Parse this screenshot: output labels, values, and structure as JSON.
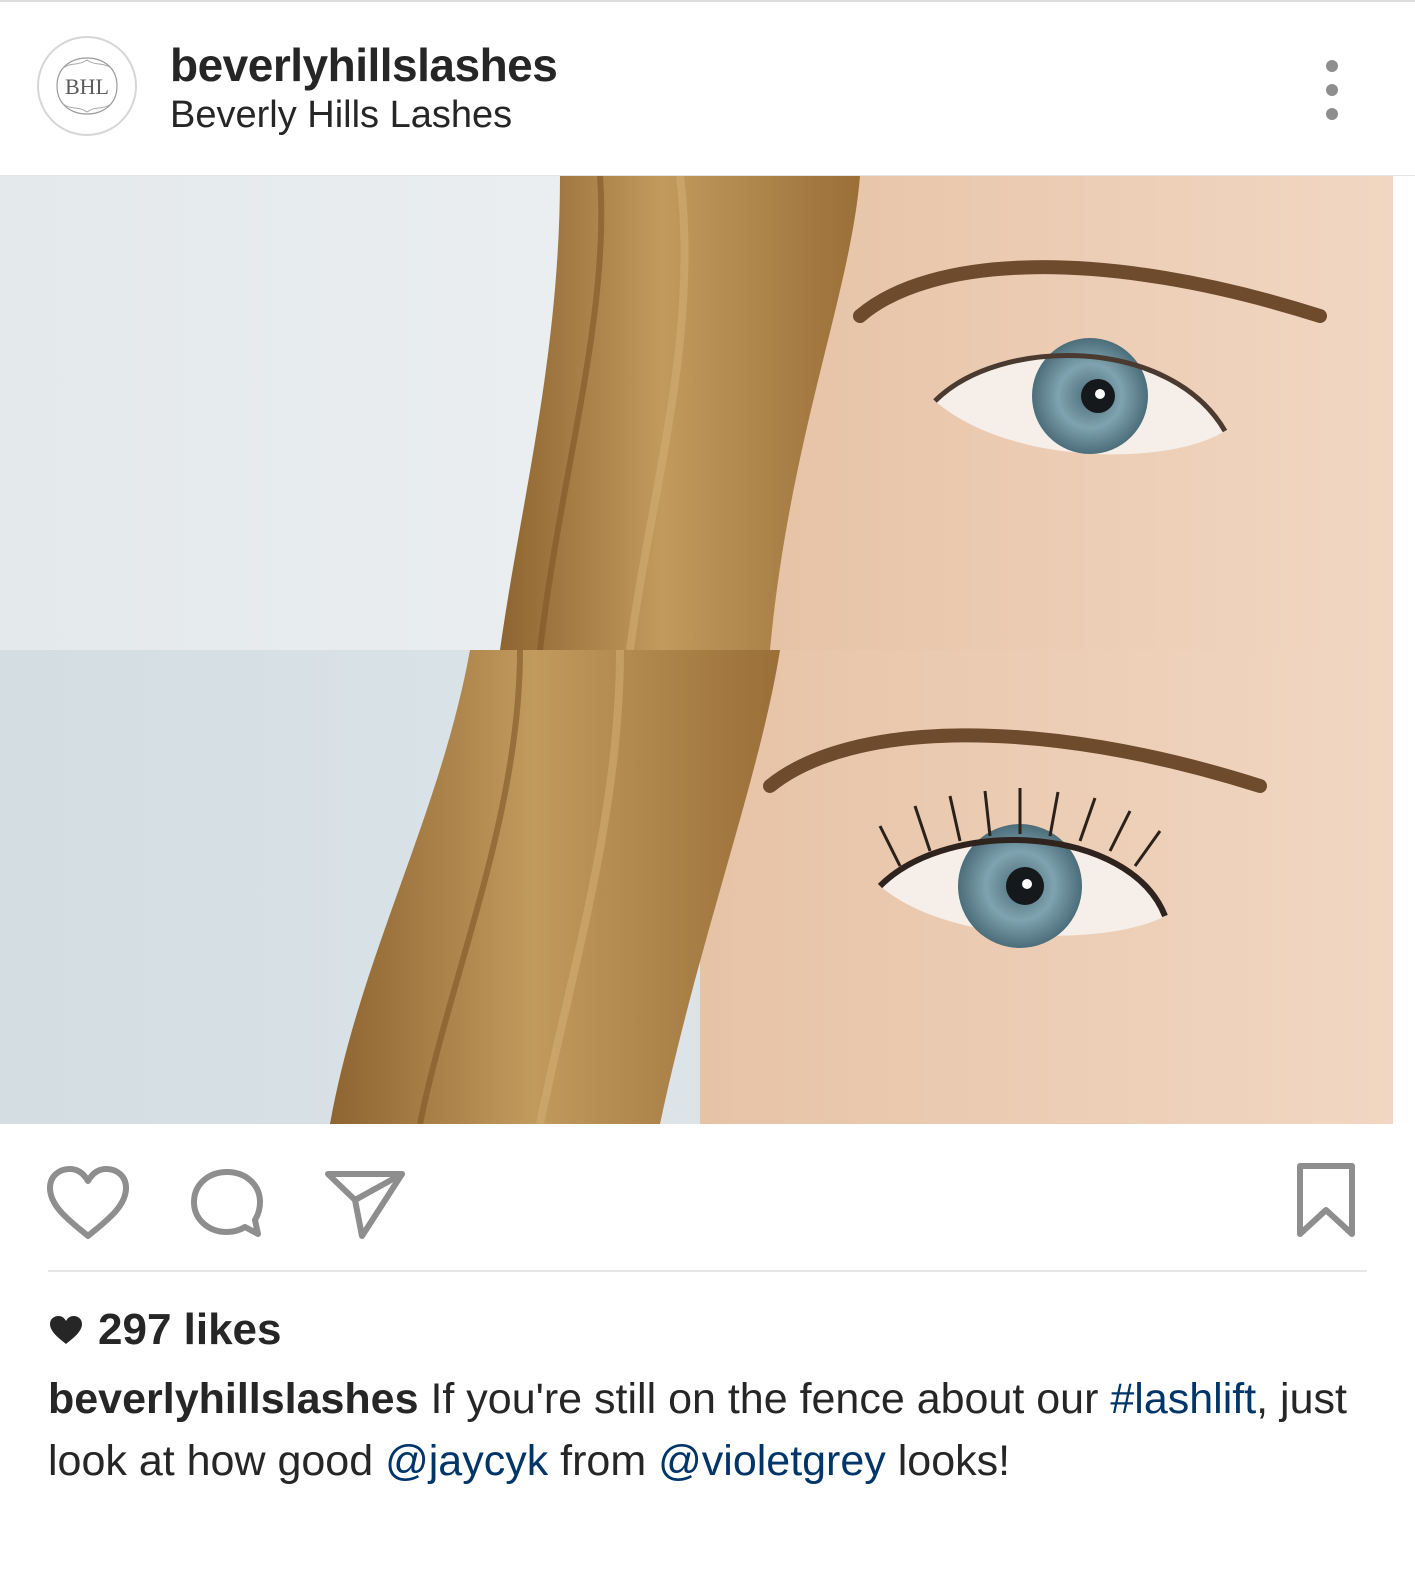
{
  "post": {
    "username": "beverlyhillslashes",
    "display_name": "Beverly Hills Lashes",
    "avatar_monogram": "BHL",
    "likes_text": "297 likes",
    "caption": {
      "author": "beverlyhillslashes",
      "text_1": "If you're still on the fence about our",
      "hashtag": "#lashlift",
      "text_2": ", just look at how good",
      "mention_1": "@jaycyk",
      "text_3": "from",
      "mention_2": "@violetgrey",
      "text_4": "looks!"
    }
  },
  "icons": {
    "more": "more-vertical-icon",
    "like": "heart-outline-icon",
    "comment": "comment-bubble-icon",
    "share": "paper-plane-icon",
    "save": "bookmark-icon",
    "likes": "heart-filled-icon"
  },
  "colors": {
    "text": "#262626",
    "link": "#003569",
    "icon": "#8e8e8e",
    "divider": "#e6e6e6"
  }
}
